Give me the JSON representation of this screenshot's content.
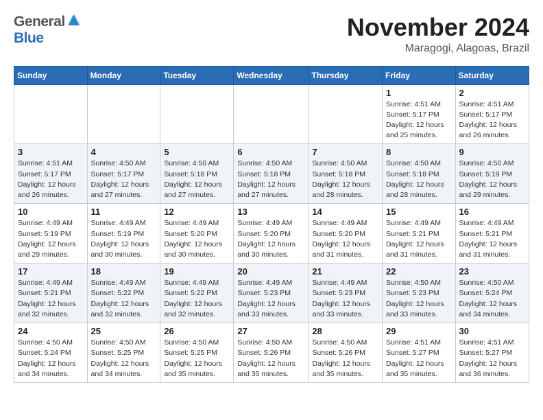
{
  "header": {
    "logo_general": "General",
    "logo_blue": "Blue",
    "month_title": "November 2024",
    "location": "Maragogi, Alagoas, Brazil"
  },
  "weekdays": [
    "Sunday",
    "Monday",
    "Tuesday",
    "Wednesday",
    "Thursday",
    "Friday",
    "Saturday"
  ],
  "weeks": [
    [
      {
        "day": "",
        "info": ""
      },
      {
        "day": "",
        "info": ""
      },
      {
        "day": "",
        "info": ""
      },
      {
        "day": "",
        "info": ""
      },
      {
        "day": "",
        "info": ""
      },
      {
        "day": "1",
        "info": "Sunrise: 4:51 AM\nSunset: 5:17 PM\nDaylight: 12 hours\nand 25 minutes."
      },
      {
        "day": "2",
        "info": "Sunrise: 4:51 AM\nSunset: 5:17 PM\nDaylight: 12 hours\nand 26 minutes."
      }
    ],
    [
      {
        "day": "3",
        "info": "Sunrise: 4:51 AM\nSunset: 5:17 PM\nDaylight: 12 hours\nand 26 minutes."
      },
      {
        "day": "4",
        "info": "Sunrise: 4:50 AM\nSunset: 5:17 PM\nDaylight: 12 hours\nand 27 minutes."
      },
      {
        "day": "5",
        "info": "Sunrise: 4:50 AM\nSunset: 5:18 PM\nDaylight: 12 hours\nand 27 minutes."
      },
      {
        "day": "6",
        "info": "Sunrise: 4:50 AM\nSunset: 5:18 PM\nDaylight: 12 hours\nand 27 minutes."
      },
      {
        "day": "7",
        "info": "Sunrise: 4:50 AM\nSunset: 5:18 PM\nDaylight: 12 hours\nand 28 minutes."
      },
      {
        "day": "8",
        "info": "Sunrise: 4:50 AM\nSunset: 5:18 PM\nDaylight: 12 hours\nand 28 minutes."
      },
      {
        "day": "9",
        "info": "Sunrise: 4:50 AM\nSunset: 5:19 PM\nDaylight: 12 hours\nand 29 minutes."
      }
    ],
    [
      {
        "day": "10",
        "info": "Sunrise: 4:49 AM\nSunset: 5:19 PM\nDaylight: 12 hours\nand 29 minutes."
      },
      {
        "day": "11",
        "info": "Sunrise: 4:49 AM\nSunset: 5:19 PM\nDaylight: 12 hours\nand 30 minutes."
      },
      {
        "day": "12",
        "info": "Sunrise: 4:49 AM\nSunset: 5:20 PM\nDaylight: 12 hours\nand 30 minutes."
      },
      {
        "day": "13",
        "info": "Sunrise: 4:49 AM\nSunset: 5:20 PM\nDaylight: 12 hours\nand 30 minutes."
      },
      {
        "day": "14",
        "info": "Sunrise: 4:49 AM\nSunset: 5:20 PM\nDaylight: 12 hours\nand 31 minutes."
      },
      {
        "day": "15",
        "info": "Sunrise: 4:49 AM\nSunset: 5:21 PM\nDaylight: 12 hours\nand 31 minutes."
      },
      {
        "day": "16",
        "info": "Sunrise: 4:49 AM\nSunset: 5:21 PM\nDaylight: 12 hours\nand 31 minutes."
      }
    ],
    [
      {
        "day": "17",
        "info": "Sunrise: 4:49 AM\nSunset: 5:21 PM\nDaylight: 12 hours\nand 32 minutes."
      },
      {
        "day": "18",
        "info": "Sunrise: 4:49 AM\nSunset: 5:22 PM\nDaylight: 12 hours\nand 32 minutes."
      },
      {
        "day": "19",
        "info": "Sunrise: 4:49 AM\nSunset: 5:22 PM\nDaylight: 12 hours\nand 32 minutes."
      },
      {
        "day": "20",
        "info": "Sunrise: 4:49 AM\nSunset: 5:23 PM\nDaylight: 12 hours\nand 33 minutes."
      },
      {
        "day": "21",
        "info": "Sunrise: 4:49 AM\nSunset: 5:23 PM\nDaylight: 12 hours\nand 33 minutes."
      },
      {
        "day": "22",
        "info": "Sunrise: 4:50 AM\nSunset: 5:23 PM\nDaylight: 12 hours\nand 33 minutes."
      },
      {
        "day": "23",
        "info": "Sunrise: 4:50 AM\nSunset: 5:24 PM\nDaylight: 12 hours\nand 34 minutes."
      }
    ],
    [
      {
        "day": "24",
        "info": "Sunrise: 4:50 AM\nSunset: 5:24 PM\nDaylight: 12 hours\nand 34 minutes."
      },
      {
        "day": "25",
        "info": "Sunrise: 4:50 AM\nSunset: 5:25 PM\nDaylight: 12 hours\nand 34 minutes."
      },
      {
        "day": "26",
        "info": "Sunrise: 4:50 AM\nSunset: 5:25 PM\nDaylight: 12 hours\nand 35 minutes."
      },
      {
        "day": "27",
        "info": "Sunrise: 4:50 AM\nSunset: 5:26 PM\nDaylight: 12 hours\nand 35 minutes."
      },
      {
        "day": "28",
        "info": "Sunrise: 4:50 AM\nSunset: 5:26 PM\nDaylight: 12 hours\nand 35 minutes."
      },
      {
        "day": "29",
        "info": "Sunrise: 4:51 AM\nSunset: 5:27 PM\nDaylight: 12 hours\nand 35 minutes."
      },
      {
        "day": "30",
        "info": "Sunrise: 4:51 AM\nSunset: 5:27 PM\nDaylight: 12 hours\nand 36 minutes."
      }
    ]
  ]
}
